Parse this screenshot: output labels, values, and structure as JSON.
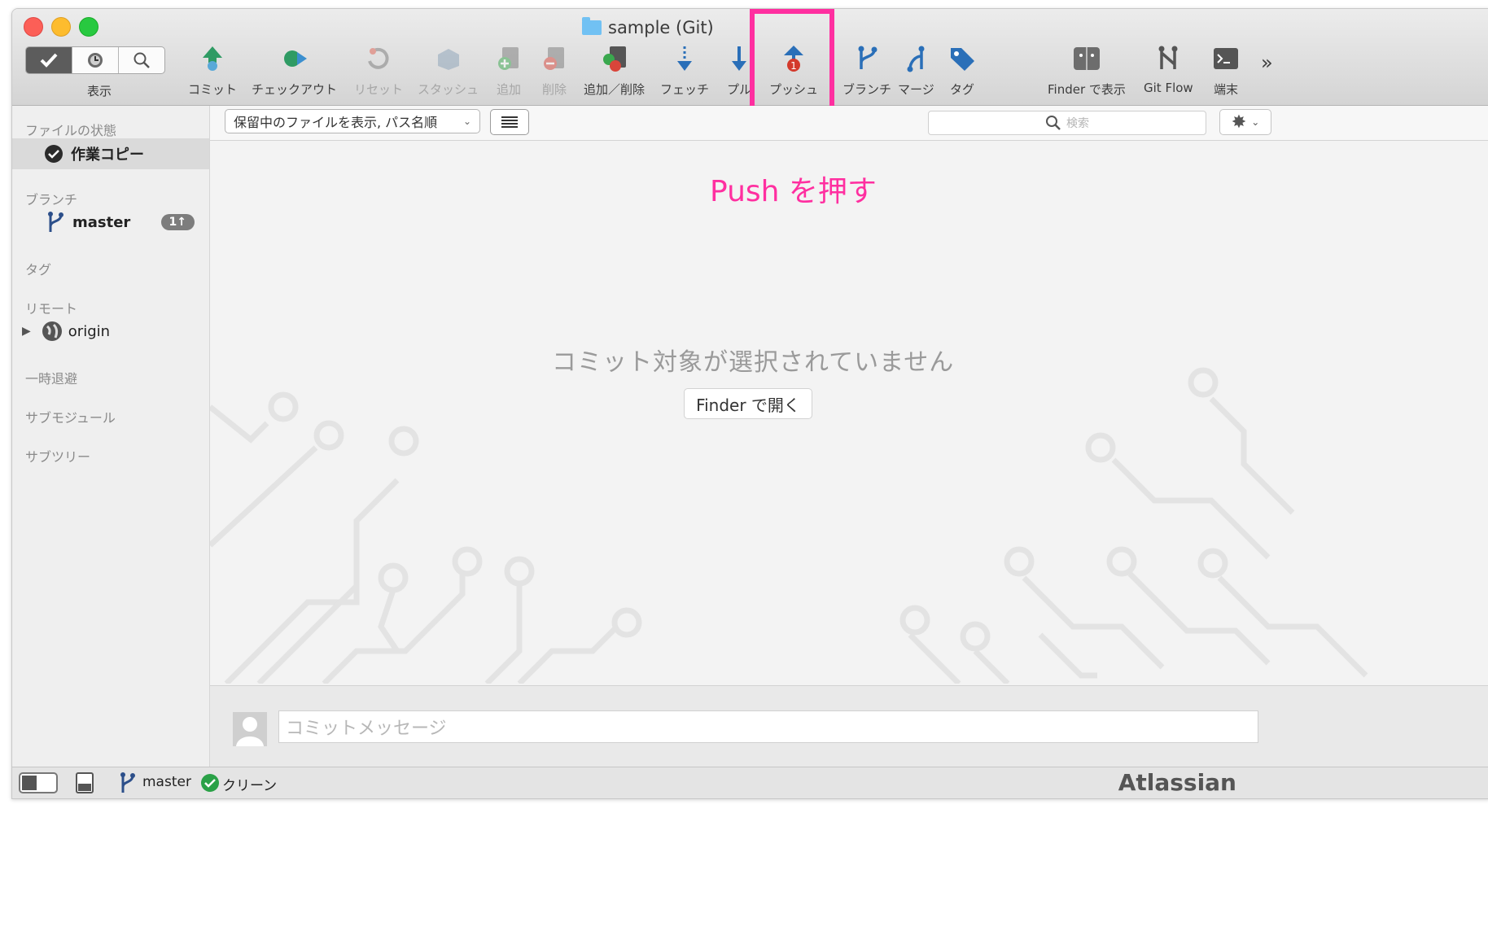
{
  "window": {
    "title": "sample (Git)"
  },
  "toolbar": {
    "view_label": "表示",
    "buttons": [
      {
        "label": "コミット",
        "icon": "commit-icon"
      },
      {
        "label": "チェックアウト",
        "icon": "checkout-icon"
      },
      {
        "label": "リセット",
        "icon": "reset-icon"
      },
      {
        "label": "スタッシュ",
        "icon": "stash-icon"
      },
      {
        "label": "追加",
        "icon": "add-icon"
      },
      {
        "label": "削除",
        "icon": "remove-icon"
      },
      {
        "label": "追加／削除",
        "icon": "add-remove-icon"
      },
      {
        "label": "フェッチ",
        "icon": "fetch-icon"
      },
      {
        "label": "プル",
        "icon": "pull-icon"
      },
      {
        "label": "プッシュ",
        "icon": "push-icon",
        "badge": "1"
      },
      {
        "label": "ブランチ",
        "icon": "branch-icon"
      },
      {
        "label": "マージ",
        "icon": "merge-icon"
      },
      {
        "label": "タグ",
        "icon": "tag-icon"
      },
      {
        "label": "Finder で表示",
        "icon": "finder-icon"
      },
      {
        "label": "Git Flow",
        "icon": "git-flow-icon"
      },
      {
        "label": "端末",
        "icon": "terminal-icon"
      }
    ],
    "overflow": "»"
  },
  "annotation": {
    "text": "Push を押す",
    "color": "#ff2fa0"
  },
  "sidebar": {
    "file_status_header": "ファイルの状態",
    "working_copy": "作業コピー",
    "branches_header": "ブランチ",
    "branch": "master",
    "branch_badge": "1↑",
    "tags_header": "タグ",
    "remotes_header": "リモート",
    "remote": "origin",
    "stashes_header": "一時退避",
    "submodules_header": "サブモジュール",
    "subtrees_header": "サブツリー"
  },
  "filter": {
    "select_value": "保留中のファイルを表示, パス名順",
    "search_placeholder": "検索"
  },
  "main": {
    "empty_message": "コミット対象が選択されていません",
    "open_finder_button": "Finder で開く",
    "commit_placeholder": "コミットメッセージ"
  },
  "statusbar": {
    "branch": "master",
    "state": "クリーン",
    "brand": "Atlassian"
  }
}
